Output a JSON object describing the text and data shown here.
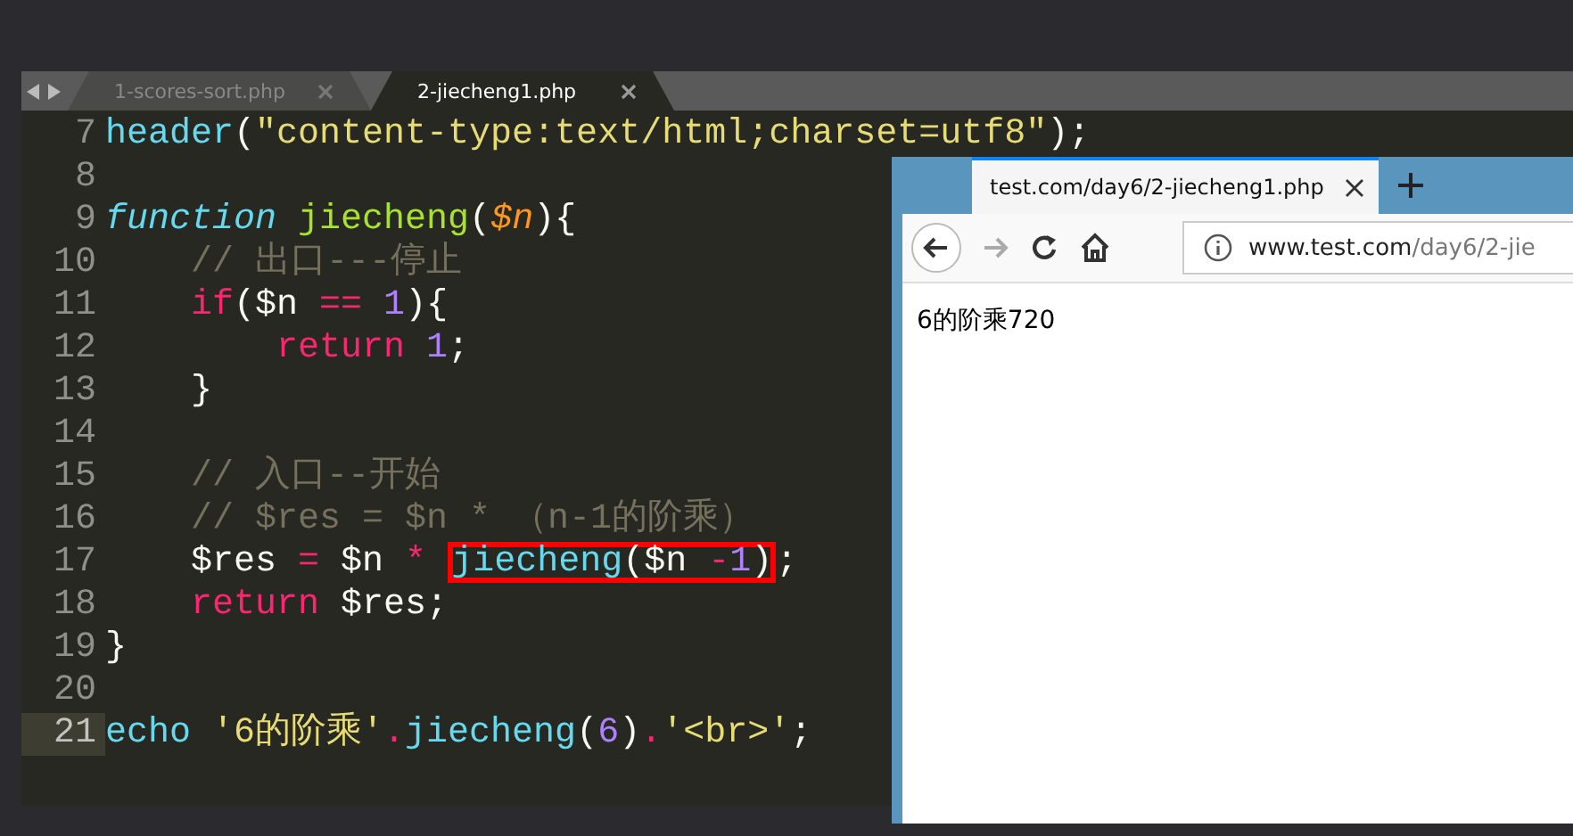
{
  "editor": {
    "tabs": [
      {
        "label": "1-scores-sort.php",
        "selected": false
      },
      {
        "label": "2-jiecheng1.php",
        "selected": true
      }
    ],
    "lines": [
      {
        "number": "7",
        "current": false,
        "tokens": [
          {
            "kind": "builtin",
            "text": "header"
          },
          {
            "kind": "plain",
            "text": "("
          },
          {
            "kind": "string",
            "text": "\"content-type:text/html;charset=utf8\""
          },
          {
            "kind": "plain",
            "text": ");"
          }
        ]
      },
      {
        "number": "8",
        "current": false
      },
      {
        "number": "9",
        "current": false,
        "tokens": [
          {
            "kind": "storage",
            "text": "function"
          },
          {
            "kind": "name",
            "text": " jiecheng"
          },
          {
            "kind": "plain",
            "text": "("
          },
          {
            "kind": "param",
            "text": "$n"
          },
          {
            "kind": "plain",
            "text": "){"
          }
        ],
        "children": [
          {
            "number": "10",
            "current": false,
            "tokens": [
              {
                "kind": "comment",
                "text": "// 出口---停止"
              }
            ]
          },
          {
            "number": "11",
            "current": false,
            "tokens": [
              {
                "kind": "keyword",
                "text": "if"
              },
              {
                "kind": "plain",
                "text": "($n "
              },
              {
                "kind": "keyword",
                "text": "=="
              },
              {
                "kind": "number",
                "text": " 1"
              },
              {
                "kind": "plain",
                "text": "){"
              }
            ],
            "children": [
              {
                "number": "12",
                "current": false,
                "tokens": [
                  {
                    "kind": "keyword",
                    "text": "return"
                  },
                  {
                    "kind": "number",
                    "text": " 1"
                  },
                  {
                    "kind": "plain",
                    "text": ";"
                  }
                ]
              }
            ]
          },
          {
            "number": "13",
            "current": false,
            "tokens": [
              {
                "kind": "plain",
                "text": "}"
              }
            ]
          },
          {
            "number": "14",
            "current": false
          },
          {
            "number": "15",
            "current": false,
            "tokens": [
              {
                "kind": "comment",
                "text": "// 入口--开始"
              }
            ]
          },
          {
            "number": "16",
            "current": false,
            "tokens": [
              {
                "kind": "comment",
                "text": "// $res = $n * （n-1的阶乘）"
              }
            ]
          },
          {
            "number": "17",
            "current": false,
            "tokens": [
              {
                "kind": "plain",
                "text": "$res "
              },
              {
                "kind": "keyword",
                "text": "="
              },
              {
                "kind": "plain",
                "text": " $n "
              },
              {
                "kind": "keyword",
                "text": "* "
              },
              {
                "kind": "builtin",
                "text": "jiecheng",
                "boxed": true
              },
              {
                "kind": "plain",
                "text": "($n ",
                "boxed": true
              },
              {
                "kind": "keyword",
                "text": "-",
                "boxed": true
              },
              {
                "kind": "number",
                "text": "1",
                "boxed": true
              },
              {
                "kind": "plain",
                "text": ")",
                "boxed": true
              },
              {
                "kind": "plain",
                "text": ";",
                "boxed": false
              }
            ]
          },
          {
            "number": "18",
            "current": false,
            "tokens": [
              {
                "kind": "keyword",
                "text": "return"
              },
              {
                "kind": "plain",
                "text": " $res;"
              }
            ]
          }
        ]
      },
      {
        "number": "19",
        "current": false,
        "tokens": [
          {
            "kind": "plain",
            "text": "}"
          }
        ]
      },
      {
        "number": "20",
        "current": false
      },
      {
        "number": "21",
        "current": true,
        "tokens": [
          {
            "kind": "builtin",
            "text": "echo"
          },
          {
            "kind": "string",
            "text": " '6的阶乘'"
          },
          {
            "kind": "keyword",
            "text": "."
          },
          {
            "kind": "builtin",
            "text": "jiecheng"
          },
          {
            "kind": "plain",
            "text": "("
          },
          {
            "kind": "number",
            "text": "6"
          },
          {
            "kind": "plain",
            "text": ")"
          },
          {
            "kind": "keyword",
            "text": "."
          },
          {
            "kind": "string",
            "text": "'<br>'"
          },
          {
            "kind": "plain",
            "text": ";"
          }
        ]
      }
    ]
  },
  "browser": {
    "tabs": [
      {
        "label": "test.com/day6/2-jiecheng1.php",
        "selected": true
      }
    ],
    "url": {
      "domain": "www.test.com",
      "path": "/day6/2-jie"
    },
    "content": "6的阶乘720"
  }
}
